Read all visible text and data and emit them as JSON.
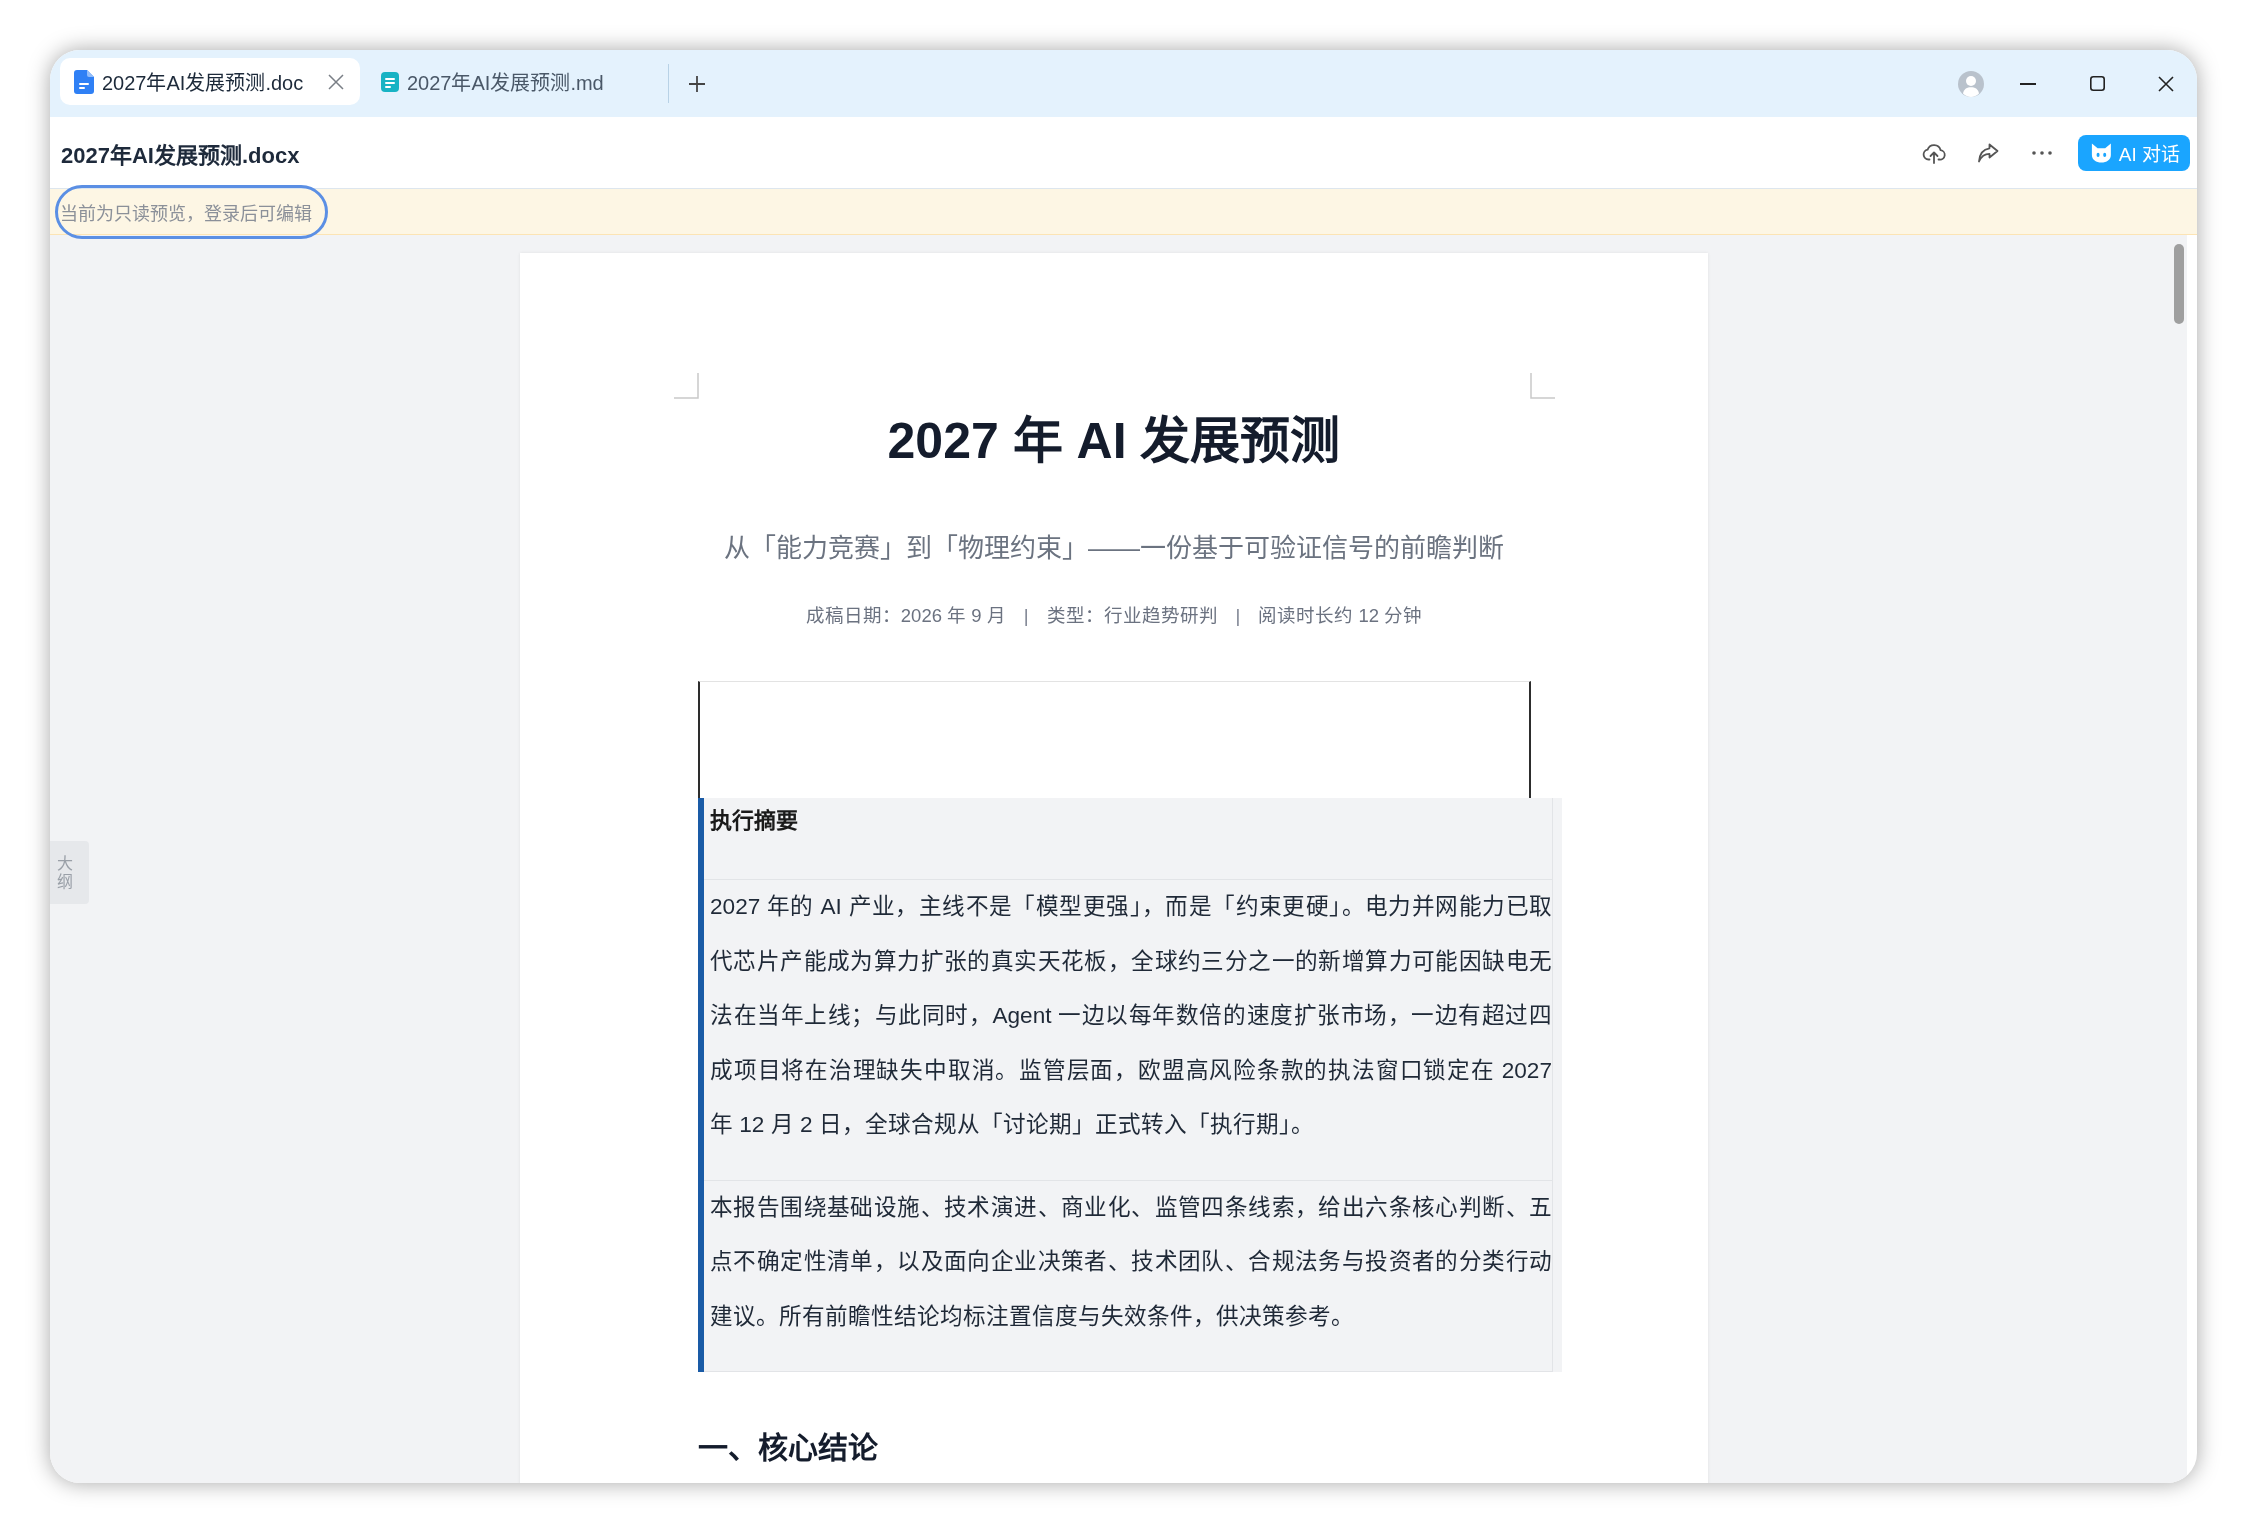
{
  "window": {
    "tabs": [
      {
        "kind": "docx",
        "label": "2027年AI发展预测.doc",
        "selected": true
      },
      {
        "kind": "md",
        "label": "2027年AI发展预测.md",
        "selected": false
      }
    ]
  },
  "toolbar": {
    "title": "2027年AI发展预测.docx",
    "ai_button": "AI 对话"
  },
  "notice": {
    "text": "当前为只读预览，登录后可编辑",
    "highlighted": true
  },
  "outline_tab": {
    "label": "大纲"
  },
  "document": {
    "title": "2027 年 AI 发展预测",
    "subtitle": "从「能力竞赛」到「物理约束」——一份基于可验证信号的前瞻判断",
    "meta": [
      {
        "kind": "text",
        "text": "成稿日期：2026 年 9 月"
      },
      {
        "kind": "separator",
        "text": "|"
      },
      {
        "kind": "text",
        "text": "类型：行业趋势研判"
      },
      {
        "kind": "separator",
        "text": "|"
      },
      {
        "kind": "text",
        "text": "阅读时长约 12 分钟"
      }
    ],
    "summary": {
      "heading": "执行摘要",
      "paragraphs": [
        "2027 年的 AI 产业，主线不是「模型更强」，而是「约束更硬」。电力并网能力已取代芯片产能成为算力扩张的真实天花板，全球约三分之一的新增算力可能因缺电无法在当年上线；与此同时，Agent 一边以每年数倍的速度扩张市场，一边有超过四成项目将在治理缺失中取消。监管层面，欧盟高风险条款的执法窗口锁定在 2027 年 12 月 2 日，全球合规从「讨论期」正式转入「执行期」。",
        "本报告围绕基础设施、技术演进、商业化、监管四条线索，给出六条核心判断、五点不确定性清单，以及面向企业决策者、技术团队、合规法务与投资者的分类行动建议。所有前瞻性结论均标注置信度与失效条件，供决策参考。"
      ]
    },
    "section_heading": "一、核心结论"
  }
}
